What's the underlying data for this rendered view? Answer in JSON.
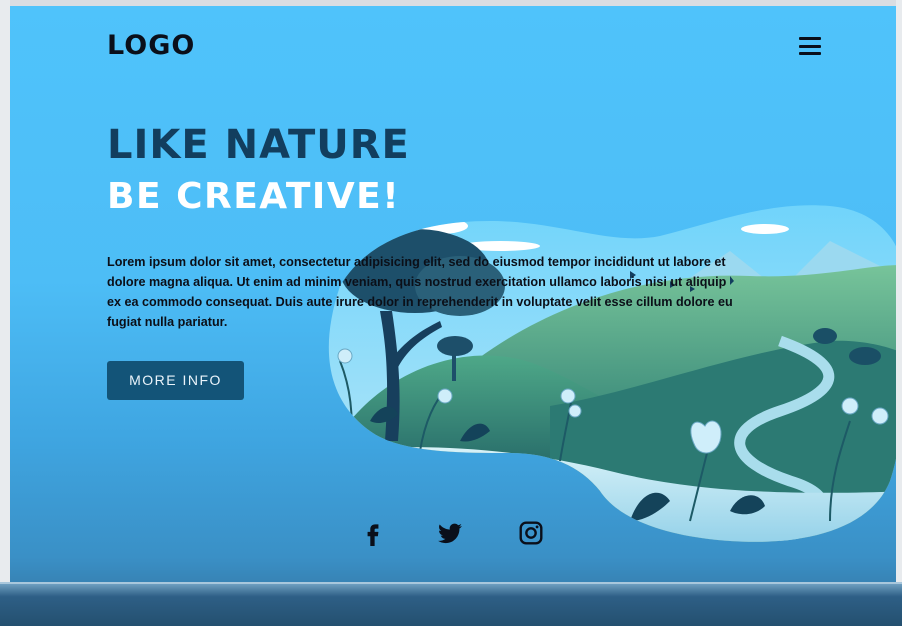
{
  "header": {
    "logo": "LOGO",
    "menu_icon": "hamburger-menu-icon"
  },
  "hero": {
    "title_line1": "LIKE NATURE",
    "title_line2": "BE CREATIVE!",
    "paragraph": "Lorem ipsum dolor sit amet, consectetur adipisicing elit, sed do eiusmod tempor incididunt ut labore et dolore magna aliqua. Ut enim ad minim veniam, quis nostrud exercitation ullamco laboris nisi ut aliquip ex ea commodo consequat. Duis aute irure dolor in reprehenderit in voluptate velit esse cillum dolore eu fugiat nulla pariatur.",
    "button_label": "MORE INFO",
    "illustration": "nature-landscape-illustration"
  },
  "social": {
    "icons": [
      "facebook-icon",
      "twitter-icon",
      "instagram-icon"
    ]
  },
  "colors": {
    "background": "#4fc3fb",
    "title_dark": "#123e5e",
    "title_light": "#ffffff",
    "button": "#135478",
    "text": "#0b0f18"
  }
}
